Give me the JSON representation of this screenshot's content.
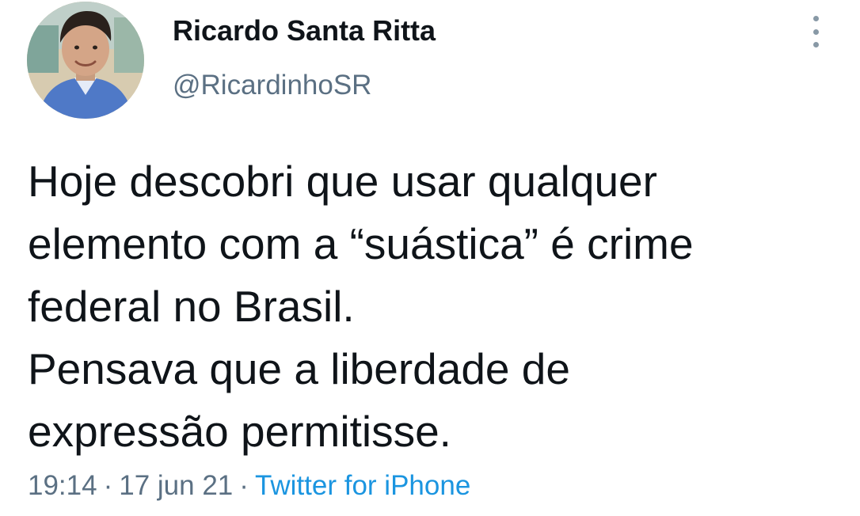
{
  "author": {
    "display_name": "Ricardo Santa Ritta",
    "handle": "@RicardinhoSR"
  },
  "more_icon": "more-vertical-icon",
  "tweet": {
    "lines": [
      "Hoje descobri que usar qualquer",
      "elemento com a “suástica” é crime",
      "federal no Brasil.",
      "Pensava que a liberdade de",
      "expressão permitisse."
    ]
  },
  "meta": {
    "time": "19:14",
    "date": "17 jun 21",
    "separator": "·",
    "source": "Twitter for iPhone"
  },
  "colors": {
    "text": "#0f1419",
    "secondary": "#5b7083",
    "link": "#1b95e0",
    "background": "#ffffff"
  }
}
